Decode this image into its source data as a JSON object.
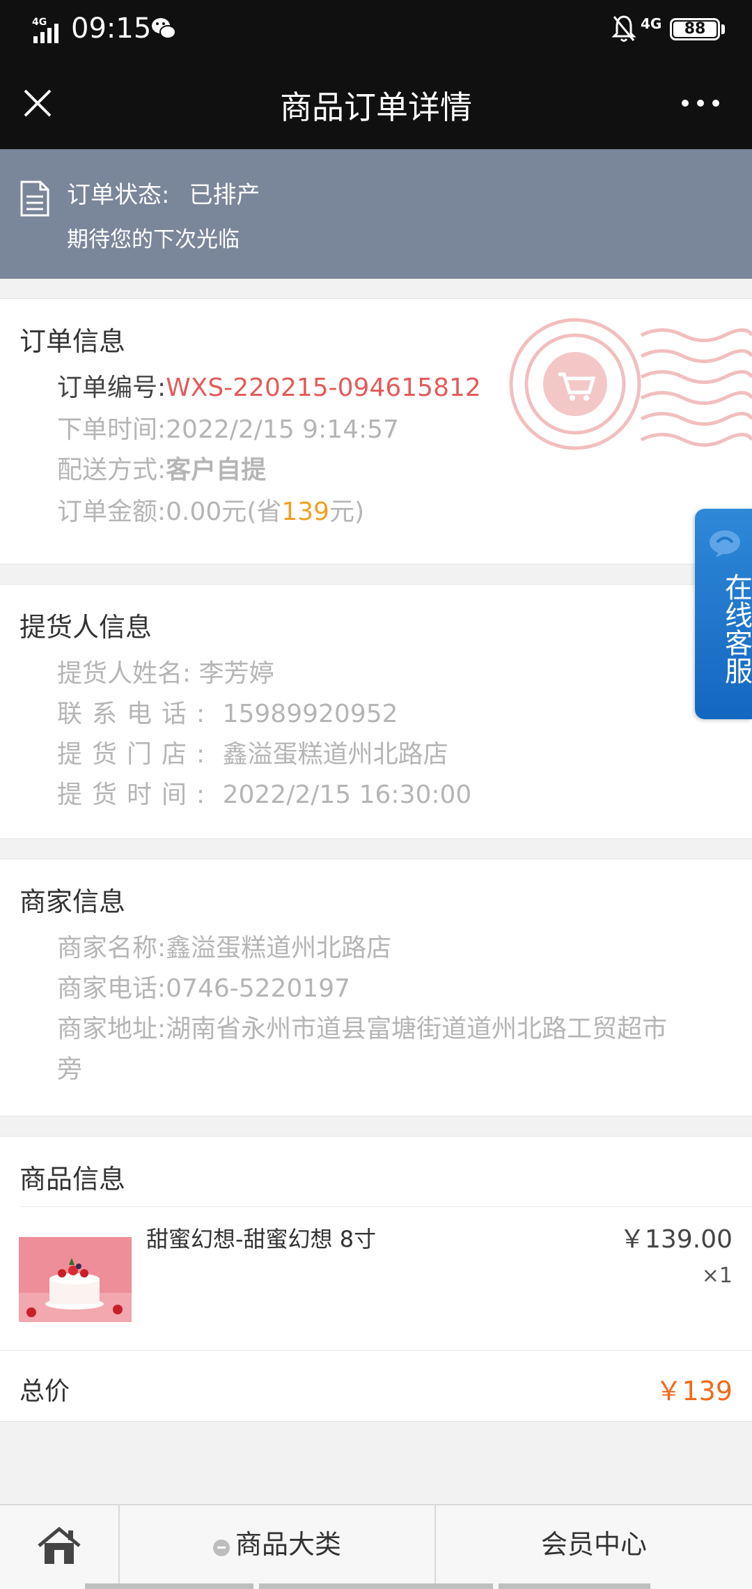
{
  "status_bar": {
    "network_left": "4G",
    "time": "09:15",
    "network_right": "4G",
    "battery": "88"
  },
  "header": {
    "title": "商品订单详情",
    "close_icon": "close-icon",
    "more_icon": "more-icon"
  },
  "banner": {
    "status_label": "订单状态:",
    "status_value": "已排产",
    "subtitle": "期待您的下次光临"
  },
  "order_info": {
    "title": "订单信息",
    "order_no_label": "订单编号:",
    "order_no": "WXS-220215-094615812",
    "time_label": "下单时间:",
    "time": "2022/2/15 9:14:57",
    "delivery_label": "配送方式:",
    "delivery": "客户自提",
    "amount_label": "订单金额:",
    "amount": "0.00元",
    "save_prefix": "(省",
    "save_value": "139",
    "save_suffix": "元)"
  },
  "pickup_info": {
    "title": "提货人信息",
    "name_label": "提货人姓名:",
    "name": "李芳婷",
    "phone_label": "联系电话:",
    "phone": "15989920952",
    "store_label": "提货门店:",
    "store": "鑫溢蛋糕道州北路店",
    "time_label": "提货时间:",
    "time": "2022/2/15 16:30:00"
  },
  "merchant_info": {
    "title": "商家信息",
    "name_label": "商家名称:",
    "name": "鑫溢蛋糕道州北路店",
    "phone_label": "商家电话:",
    "phone": "0746-5220197",
    "address_label": "商家地址:",
    "address_line1": "湖南省永州市道县富塘街道道州北路工贸超市",
    "address_line2": "旁"
  },
  "goods_info": {
    "title": "商品信息",
    "item_name": "甜蜜幻想-甜蜜幻想 8寸",
    "item_price": "￥139.00",
    "item_qty": "×1",
    "total_label": "总价",
    "total_value": "￥139"
  },
  "float_service": {
    "label": "在线客服"
  },
  "bottom_nav": {
    "home_icon": "home-icon",
    "category": "商品大类",
    "member": "会员中心"
  },
  "colors": {
    "header_bg": "#101010",
    "banner_bg": "#7a8699",
    "order_no": "#e35b5b",
    "total": "#f26a1b",
    "save_value": "#f0a020",
    "service_blue": "#1f78cc"
  }
}
